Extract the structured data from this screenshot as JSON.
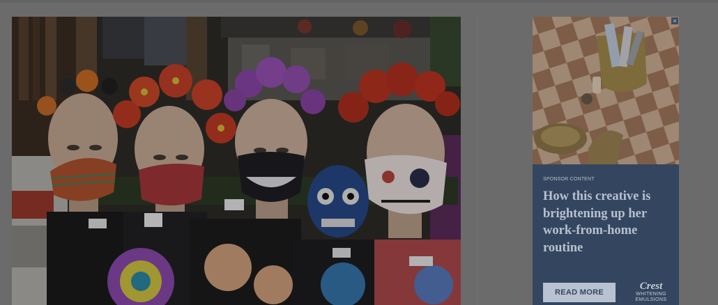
{
  "ad": {
    "sponsor_label": "SPONSOR CONTENT",
    "headline": "How this creative is brightening up her work-from-home routine",
    "cta_label": "READ MORE",
    "brand_name": "Crest",
    "brand_line1": "WHITENING",
    "brand_line2": "EMULSIONS",
    "close_glyph": "×",
    "colors": {
      "panel": "#34465f",
      "headline": "#b7c1cf",
      "button": "#b8c2d0"
    }
  },
  "page": {
    "overlay_color": "#6b6b6b"
  }
}
